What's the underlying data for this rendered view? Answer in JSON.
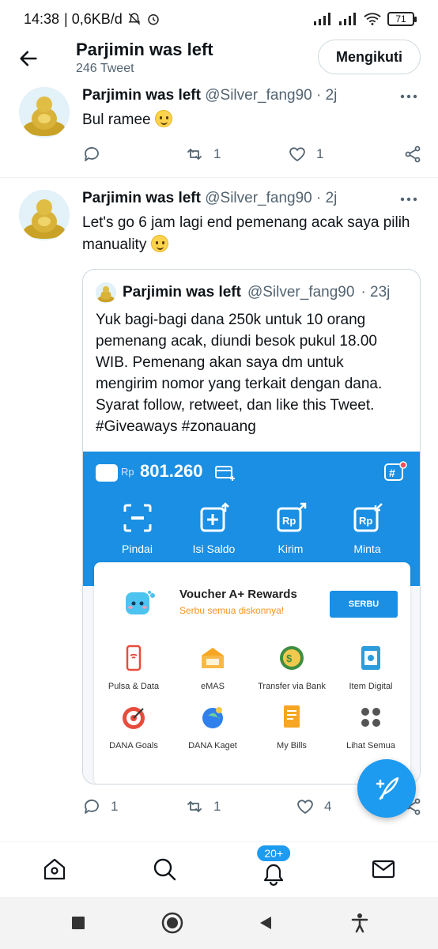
{
  "status_bar": {
    "time": "14:38",
    "data_speed": "0,6KB/d",
    "battery": "71"
  },
  "header": {
    "title": "Parjimin was left",
    "tweet_count": "246 Tweet",
    "follow_label": "Mengikuti"
  },
  "tweets": [
    {
      "name": "Parjimin was left",
      "handle": "@Silver_fang90",
      "time": "· 2j",
      "text": "Bul ramee",
      "replies": "",
      "retweets": "1",
      "likes": "1"
    },
    {
      "name": "Parjimin was left",
      "handle": "@Silver_fang90",
      "time": "· 2j",
      "text": "Let's go 6 jam lagi end pemenang acak saya pilih manuality",
      "replies": "1",
      "retweets": "1",
      "likes": "4",
      "quote": {
        "name": "Parjimin was left",
        "handle": "@Silver_fang90",
        "time": "· 23j",
        "text": "Yuk bagi-bagi dana 250k untuk 10 orang pemenang acak, diundi besok pukul 18.00 WIB. Pemenang akan saya dm untuk mengirim nomor yang terkait dengan dana. Syarat follow, retweet, dan like this Tweet. #Giveaways #zonauang",
        "image": {
          "currency": "Rp",
          "balance": "801.260",
          "menu": [
            "Pindai",
            "Isi Saldo",
            "Kirim",
            "Minta"
          ],
          "voucher_title": "Voucher A+ Rewards",
          "voucher_subtitle": "Serbu semua diskonnya!",
          "voucher_button": "SERBU",
          "services": [
            "Pulsa & Data",
            "eMAS",
            "Transfer via Bank",
            "Item Digital",
            "DANA Goals",
            "DANA Kaget",
            "My Bills",
            "Lihat Semua"
          ]
        }
      }
    }
  ],
  "bottom_nav": {
    "notifications_badge": "20+"
  },
  "colors": {
    "twitter_blue": "#1d9bf0",
    "dana_blue": "#1a8fe3",
    "text_secondary": "#536471"
  }
}
